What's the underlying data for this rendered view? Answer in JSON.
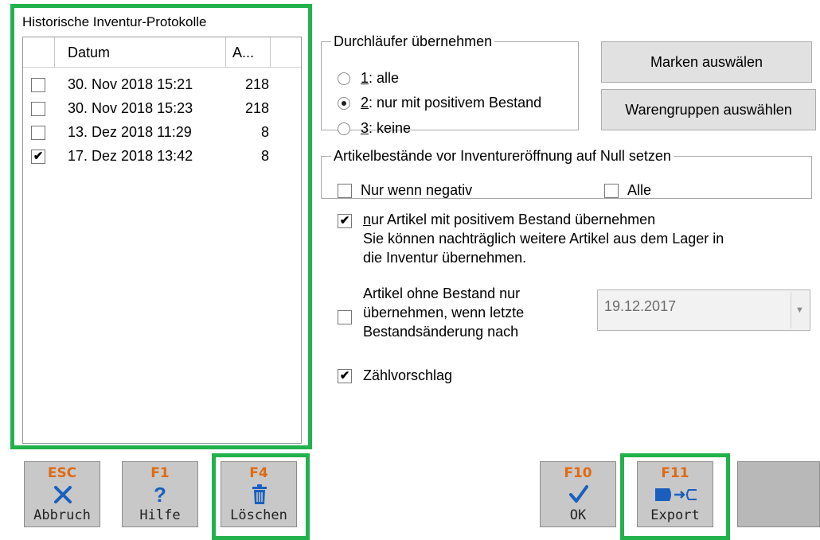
{
  "protocols": {
    "title": "Historische Inventur-Protokolle",
    "columns": {
      "date": "Datum",
      "count": "A..."
    },
    "rows": [
      {
        "date": "30. Nov 2018 15:21",
        "count": "218",
        "checked": false
      },
      {
        "date": "30. Nov 2018 15:23",
        "count": "218",
        "checked": false
      },
      {
        "date": "13. Dez 2018 11:29",
        "count": "8",
        "checked": false
      },
      {
        "date": "17. Dez 2018 13:42",
        "count": "8",
        "checked": true
      }
    ]
  },
  "durchlaeufer": {
    "legend": "Durchläufer übernehmen",
    "options": [
      {
        "key": "1",
        "text": ": alle",
        "selected": false
      },
      {
        "key": "2",
        "text": ": nur mit positivem Bestand",
        "selected": true
      },
      {
        "key": "3",
        "text": ": keine",
        "selected": false
      }
    ]
  },
  "buttons": {
    "marken": "Marken auswälen",
    "warengruppen": "Warengruppen auswählen"
  },
  "nullsetzen": {
    "legend": "Artikelbestände vor Inventureröffnung auf Null setzen",
    "negativ": "Nur wenn negativ",
    "alle": "Alle",
    "negativ_checked": false,
    "alle_checked": false
  },
  "positiv": {
    "key": "n",
    "line1": "ur Artikel mit positivem Bestand übernehmen",
    "line2": "Sie können nachträglich weitere Artikel aus dem Lager in",
    "line3": "die Inventur übernehmen.",
    "checked": true
  },
  "ohne_bestand": {
    "line1": "Artikel ohne Bestand nur",
    "line2": "übernehmen, wenn letzte",
    "line3": "Bestandsänderung nach",
    "checked": false,
    "date_value": "19.12.2017"
  },
  "zaehlvorschlag": {
    "label": "Zählvorschlag",
    "checked": true
  },
  "fbuttons": [
    {
      "key": "ESC",
      "label": "Abbruch",
      "icon": "x-icon"
    },
    {
      "key": "F1",
      "label": "Hilfe",
      "icon": "question-icon"
    },
    {
      "key": "F4",
      "label": "Löschen",
      "icon": "trash-icon"
    },
    {
      "key": "F10",
      "label": "OK",
      "icon": "check-icon"
    },
    {
      "key": "F11",
      "label": "Export",
      "icon": "export-icon"
    }
  ],
  "colors": {
    "highlight": "#22b24c",
    "fkey": "#e06a10",
    "button_gray": "#c8c8c8"
  }
}
